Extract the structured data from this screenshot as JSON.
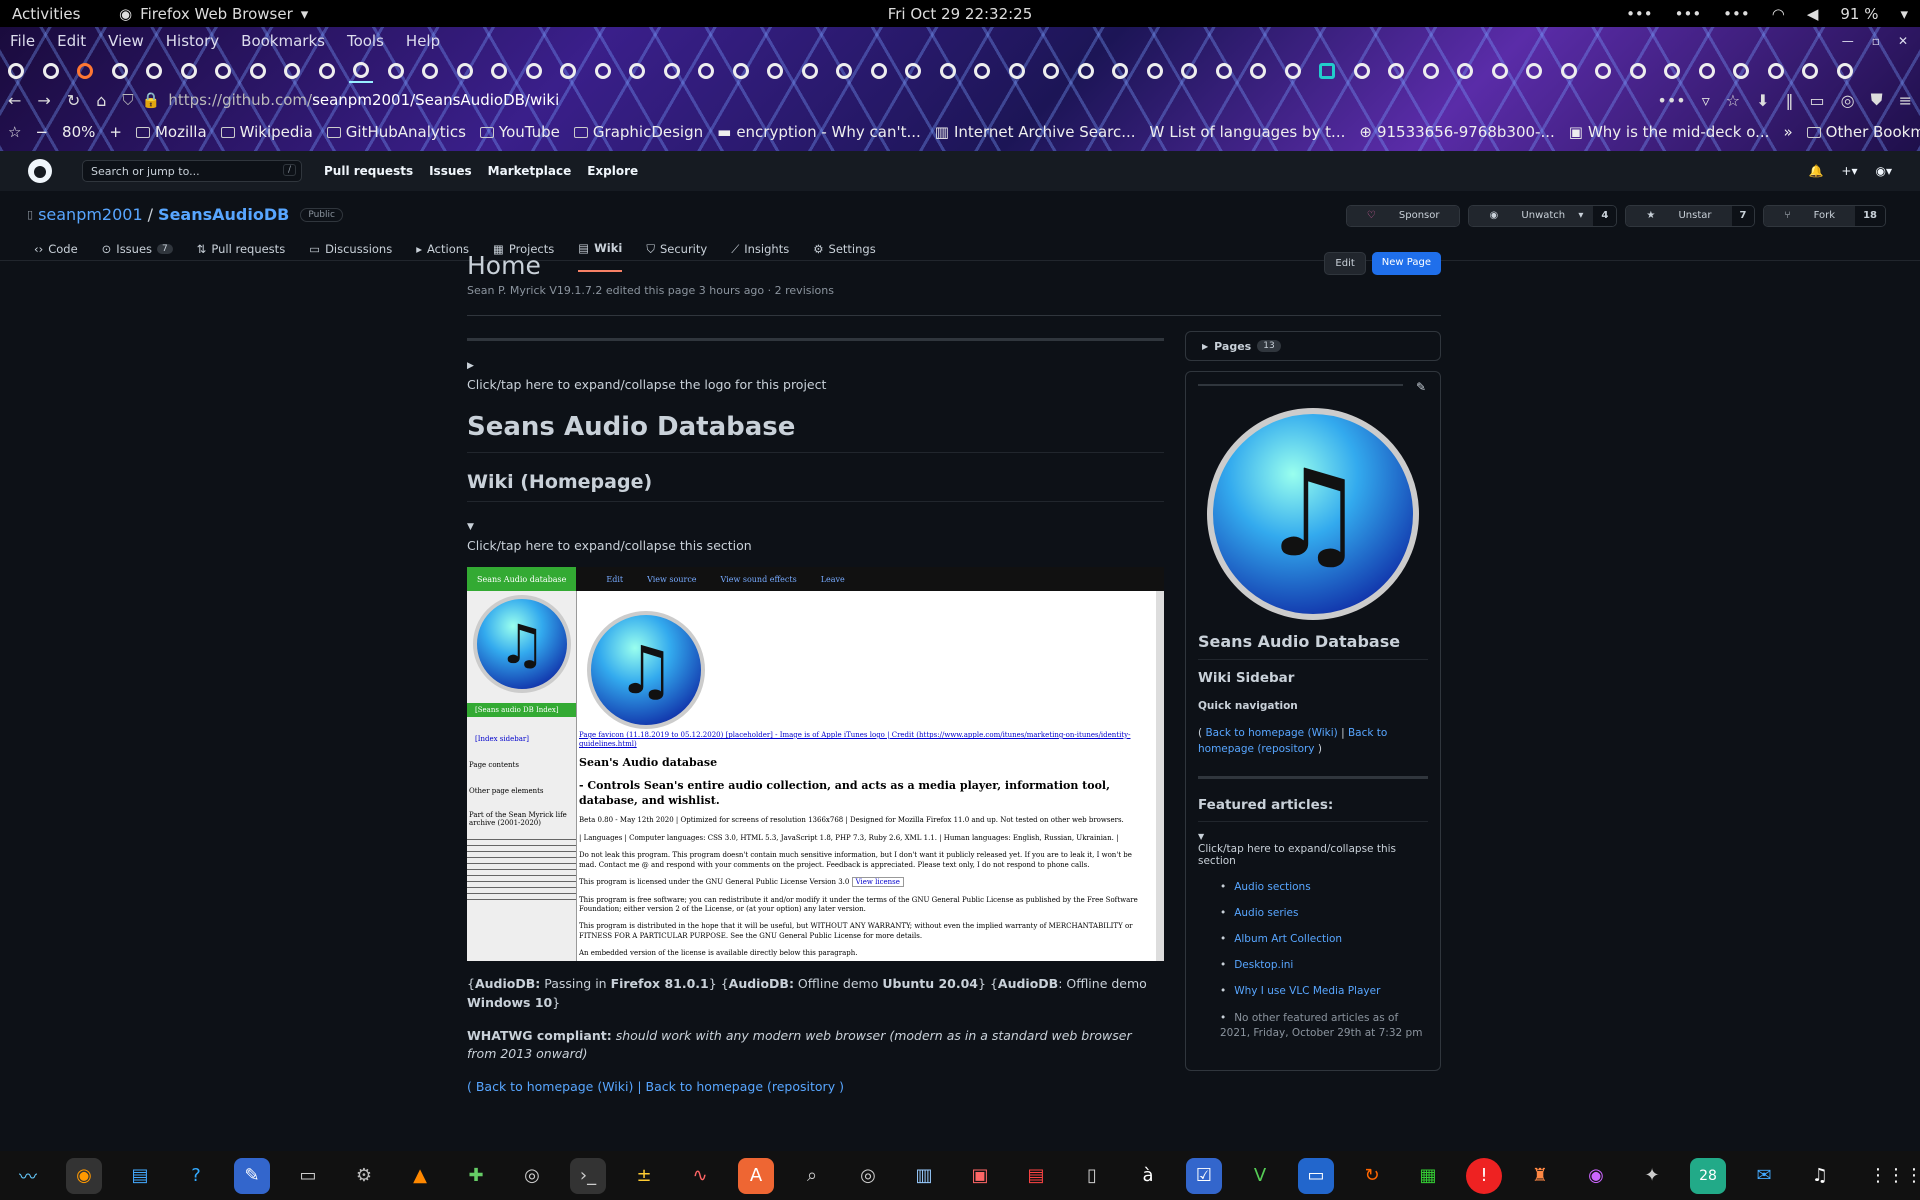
{
  "os": {
    "activities": "Activities",
    "app": "Firefox Web Browser",
    "clock": "Fri Oct 29  22:32:25",
    "battery": "91 %"
  },
  "menu": [
    "File",
    "Edit",
    "View",
    "History",
    "Bookmarks",
    "Tools",
    "Help"
  ],
  "nav": {
    "url_host": "https://github.com/",
    "url_path": "seanpm2001/SeansAudioDB/wiki",
    "zoom": "80%"
  },
  "bookmarks": [
    "Mozilla",
    "Wikipedia",
    "GitHubAnalytics",
    "YouTube",
    "GraphicDesign",
    "encryption - Why can't...",
    "Internet Archive Searc...",
    "List of languages by t...",
    "91533656-9768b300-...",
    "Why is the mid-deck o...",
    "Other Bookmarks"
  ],
  "gh": {
    "search": "Search or jump to...",
    "search_key": "/",
    "links": [
      "Pull requests",
      "Issues",
      "Marketplace",
      "Explore"
    ]
  },
  "repo": {
    "owner": "seanpm2001",
    "sep": "/",
    "name": "SeansAudioDB",
    "visibility": "Public",
    "sponsor": "Sponsor",
    "unwatch": "Unwatch",
    "watch_count": "4",
    "unstar": "Unstar",
    "star_count": "7",
    "fork": "Fork",
    "fork_count": "18"
  },
  "tabs": [
    {
      "label": "Code"
    },
    {
      "label": "Issues",
      "count": "7"
    },
    {
      "label": "Pull requests"
    },
    {
      "label": "Discussions"
    },
    {
      "label": "Actions"
    },
    {
      "label": "Projects"
    },
    {
      "label": "Wiki"
    },
    {
      "label": "Security"
    },
    {
      "label": "Insights"
    },
    {
      "label": "Settings"
    }
  ],
  "page": {
    "title": "Home",
    "meta": "Sean P. Myrick V19.1.7.2 edited this page 3 hours ago · 2 revisions",
    "edit": "Edit",
    "new_page": "New Page"
  },
  "content": {
    "logo_toggle": "Click/tap here to expand/collapse the logo for this project",
    "h1": "Seans Audio Database",
    "h2": "Wiki (Homepage)",
    "section_toggle": "Click/tap here to expand/collapse this section",
    "shot": {
      "bar_title": "Seans Audio database",
      "bar_links": [
        "Edit",
        "View source",
        "View sound effects",
        "Leave"
      ],
      "side_green": "[Seans audio DB Index]",
      "side_items": [
        "[Index sidebar]",
        "Page contents",
        "Other page elements",
        "Part of the Sean Myrick life archive (2001-2020)"
      ],
      "favicon": "Page favicon (11.18.2019 to 05.12.2020) [placeholder] - Image is of Apple iTunes logo | Credit (https://www.apple.com/itunes/marketing-on-itunes/identity-guidelines.html)",
      "h": "Sean's Audio database",
      "sub": "- Controls Sean's entire audio collection, and acts as a media player, information tool, database, and wishlist.",
      "l1": "Beta 0.80 - May 12th 2020 | Optimized for screens of resolution 1366x768 | Designed for Mozilla Firefox 11.0 and up. Not tested on other web browsers.",
      "l2": "| Languages | Computer languages: CSS 3.0, HTML 5.3, JavaScript 1.8, PHP 7.3, Ruby 2.6, XML 1.1. | Human languages: English, Russian, Ukrainian. |",
      "l3": "Do not leak this program. This program doesn't contain much sensitive information, but I don't want it publicly released yet. If you are to leak it, I won't be mad. Contact me @ and respond with your comments on the project. Feedback is appreciated. Please text only, I do not respond to phone calls.",
      "l4": "This program is licensed under the GNU General Public License Version 3.0",
      "l4b": "View license",
      "l5": "This program is free software; you can redistribute it and/or modify it under the terms of the GNU General Public License as published by the Free Software Foundation; either version 2 of the License, or (at your option) any later version.",
      "l6": "This program is distributed in the hope that it will be useful, but WITHOUT ANY WARRANTY; without even the implied warranty of MERCHANTABILITY or FITNESS FOR A PARTICULAR PURPOSE. See the GNU General Public License for more details.",
      "l7": "An embedded version of the license is available directly below this paragraph."
    },
    "status": {
      "a": "AudioDB:",
      "b": " Passing in ",
      "c": "Firefox 81.0.1",
      "d": "} {",
      "e": "AudioDB:",
      "f": " Offline demo ",
      "g": "Ubuntu 20.04",
      "h": "} {",
      "i": "AudioDB",
      "j": ": Offline demo ",
      "k": "Windows 10",
      "open": "{",
      "close": "}"
    },
    "whatwg_label": "WHATWG compliant:",
    "whatwg_text": "should work with any modern web browser (modern as in a standard web browser from 2013 onward)",
    "back_wiki": "Back to homepage (Wiki)",
    "back_repo": "Back to homepage (repository",
    "paren_open": "( ",
    "pipe": " | ",
    "paren_close": " )"
  },
  "sidebar": {
    "pages": "Pages",
    "pages_count": "13",
    "title": "Seans Audio Database",
    "subtitle": "Wiki Sidebar",
    "quick": "Quick navigation",
    "back_wiki": "Back to homepage (Wiki)",
    "back_repo": "Back to homepage (repository",
    "po": "( ",
    "pipe": " | ",
    "pc": " )",
    "featured": "Featured articles:",
    "toggle": "Click/tap here to expand/collapse this section",
    "items": [
      "Audio sections",
      "Audio series",
      "Album Art Collection",
      "Desktop.ini",
      "Why I use VLC Media Player"
    ],
    "note": "No other featured articles as of 2021, Friday, October 29th at 7:32 pm"
  },
  "dock_badge": "28"
}
